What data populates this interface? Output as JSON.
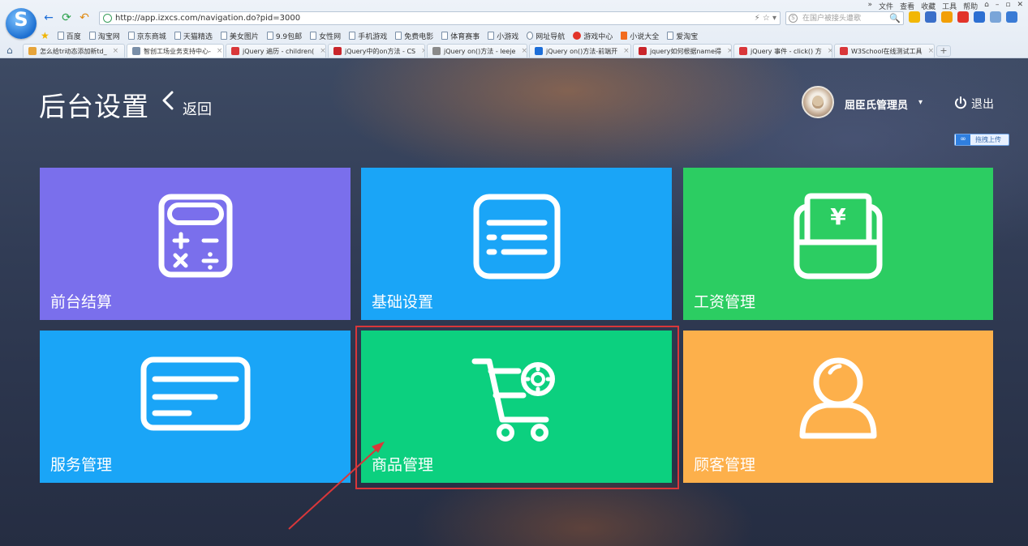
{
  "browser": {
    "menu": [
      "»",
      "文件",
      "查看",
      "收藏",
      "工具",
      "帮助",
      "⌂",
      "–",
      "▫",
      "✕"
    ],
    "url": "http://app.izxcs.com/navigation.do?pid=3000",
    "url_right": "⚡ ☆ ▾",
    "search_placeholder": "在国户被接头遭歌",
    "search_button": "🔍",
    "favorites": [
      {
        "label": "百度",
        "icon": "page-icon"
      },
      {
        "label": "淘宝网",
        "icon": "page-icon"
      },
      {
        "label": "京东商城",
        "icon": "page-icon"
      },
      {
        "label": "天猫精选",
        "icon": "page-icon"
      },
      {
        "label": "美女图片",
        "icon": "page-icon"
      },
      {
        "label": "9.9包邮",
        "icon": "page-icon"
      },
      {
        "label": "女性网",
        "icon": "page-icon"
      },
      {
        "label": "手机游戏",
        "icon": "page-icon"
      },
      {
        "label": "免费电影",
        "icon": "page-icon"
      },
      {
        "label": "体育赛事",
        "icon": "page-icon"
      },
      {
        "label": "小游戏",
        "icon": "page-icon"
      },
      {
        "label": "网址导航",
        "icon": "globe-icon"
      },
      {
        "label": "游戏中心",
        "icon": "red-dot-icon"
      },
      {
        "label": "小说大全",
        "icon": "orange-square-icon"
      },
      {
        "label": "爱淘宝",
        "icon": "page-icon"
      }
    ],
    "tabs": [
      {
        "label": "怎么给tr动态添加新td_",
        "color": "#e6a43a",
        "active": false
      },
      {
        "label": "智创工场业务支持中心-",
        "color": "#7a8fa8",
        "active": true
      },
      {
        "label": "jQuery 遍历 - children(",
        "color": "#d9373a",
        "active": false
      },
      {
        "label": "jQuery中的on方法 - CS",
        "color": "#c9252b",
        "active": false
      },
      {
        "label": "jQuery on()方法 - leeje",
        "color": "#8a8a8a",
        "active": false
      },
      {
        "label": "jQuery on()方法-前端开",
        "color": "#1d6ed8",
        "active": false
      },
      {
        "label": "jquery如何根据name得",
        "color": "#c9252b",
        "active": false
      },
      {
        "label": "jQuery 事件 - click() 方",
        "color": "#d9373a",
        "active": false
      },
      {
        "label": "W3School在线测试工具",
        "color": "#d9373a",
        "active": false
      }
    ],
    "tab_close": "×",
    "tab_add": "+"
  },
  "header": {
    "title": "后台设置",
    "back_label": "返回",
    "username": "屈臣氏管理员",
    "user_caret": "▾",
    "logout_label": "退出",
    "upload_badge": "拖拽上传"
  },
  "tiles": [
    {
      "label": "前台结算",
      "icon": "calculator-icon",
      "color": "#7a6fec"
    },
    {
      "label": "基础设置",
      "icon": "list-icon",
      "color": "#1aa5f7"
    },
    {
      "label": "工资管理",
      "icon": "wallet-yen-icon",
      "color": "#2ccd62"
    },
    {
      "label": "服务管理",
      "icon": "card-icon",
      "color": "#1aa5f7"
    },
    {
      "label": "商品管理",
      "icon": "cart-gear-icon",
      "color": "#0cd07f"
    },
    {
      "label": "顾客管理",
      "icon": "user-icon",
      "color": "#fdb04b"
    }
  ],
  "annotation": {
    "color": "#d9373a",
    "target": "商品管理"
  }
}
